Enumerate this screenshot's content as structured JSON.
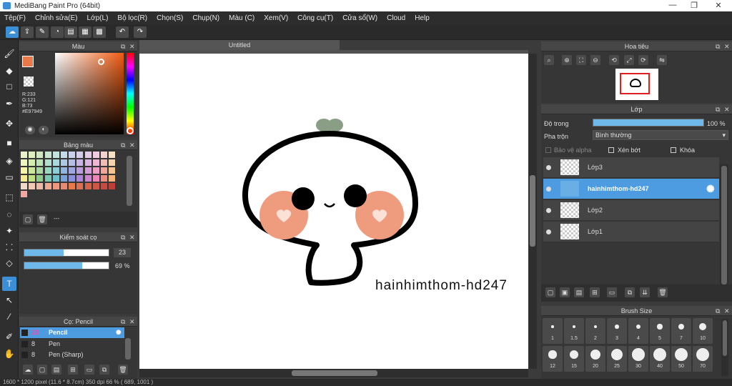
{
  "window": {
    "title": "MediBang Paint Pro (64bit)",
    "min": "—",
    "max": "❐",
    "close": "✕"
  },
  "menu": [
    "Tệp(F)",
    "Chỉnh sửa(E)",
    "Lớp(L)",
    "Bộ lọc(R)",
    "Chọn(S)",
    "Chụp(N)",
    "Màu (C)",
    "Xem(V)",
    "Công cụ(T)",
    "Cửa sổ(W)",
    "Cloud",
    "Help"
  ],
  "canvas": {
    "tab_title": "Untitled",
    "watermark": "hainhimthom-hd247"
  },
  "color_panel": {
    "title": "Màu",
    "r": "R:233",
    "g": "G:121",
    "b": "B:73",
    "hex": "#E97949",
    "primary_color": "#E97949"
  },
  "palette_panel": {
    "title": "Bảng màu",
    "footer_text": "---",
    "colors": [
      "#e9f3c8",
      "#dff0c0",
      "#cfe8bf",
      "#c6e6d0",
      "#c3e3e0",
      "#c4dbe9",
      "#c9d1ea",
      "#d5cbea",
      "#e3cbe8",
      "#f0cde0",
      "#f3d3cc",
      "#f5e0c4",
      "#eef5c0",
      "#d6edb1",
      "#bde3b4",
      "#b2dfcd",
      "#aad8dc",
      "#acc9e4",
      "#b6bee7",
      "#c8b5e6",
      "#dcb4e3",
      "#efb6d4",
      "#f2bcb2",
      "#f4d3ae",
      "#f6f4a9",
      "#cce59e",
      "#a6d8a0",
      "#97d6c1",
      "#8dcdd5",
      "#92b5df",
      "#a0a6e2",
      "#bb9ddf",
      "#d79bdc",
      "#ee9ec4",
      "#f1a698",
      "#f3c492",
      "#f7e990",
      "#c0de86",
      "#8ccb88",
      "#7bc9b2",
      "#70c0cc",
      "#7aa2d8",
      "#8b90dc",
      "#ad86d9",
      "#cf83d5",
      "#ec86b6",
      "#ef8d7e",
      "#f3b47a",
      "#f5d9c8",
      "#f2c9b6",
      "#eeb8a6",
      "#f0a890",
      "#ee9880",
      "#e88a70",
      "#e97949",
      "#e06f52",
      "#d9614a",
      "#cf5544",
      "#c94a3f",
      "#bf3e38",
      "#f3a7a0"
    ]
  },
  "brush_control": {
    "title": "Kiểm soát cọ",
    "size": "23",
    "opacity": "69 %",
    "size_frac": 0.47,
    "opacity_frac": 0.69
  },
  "brush_panel": {
    "title": "Cọ: Pencil",
    "items": [
      {
        "size": "23",
        "name": "Pencil",
        "selected": true
      },
      {
        "size": "8",
        "name": "Pen",
        "selected": false
      },
      {
        "size": "8",
        "name": "Pen (Sharp)",
        "selected": false
      }
    ]
  },
  "navigator": {
    "title": "Hoa tiêu"
  },
  "layer_panel": {
    "title": "Lớp",
    "opacity_label": "Độ trong",
    "opacity_value": "100 %",
    "opacity_frac": 1.0,
    "blend_label": "Pha trộn",
    "blend_value": "Bình thường",
    "protect_alpha": "Bảo vệ alpha",
    "clipping": "Xén bớt",
    "lock": "Khóa",
    "layers": [
      {
        "name": "Lớp3",
        "selected": false
      },
      {
        "name": "hainhimthom-hd247",
        "selected": true
      },
      {
        "name": "Lớp2",
        "selected": false
      },
      {
        "name": "Lớp1",
        "selected": false
      }
    ]
  },
  "brush_size_panel": {
    "title": "Brush Size",
    "row1": [
      "1",
      "1.5",
      "2",
      "3",
      "4",
      "5",
      "7",
      "10"
    ],
    "row2": [
      "12",
      "15",
      "20",
      "25",
      "30",
      "40",
      "50",
      "70"
    ]
  },
  "status": {
    "text": "1600 * 1200 pixel   (11.6 * 8.7cm)   350 dpi   66 %   ( 689, 1001 )"
  }
}
